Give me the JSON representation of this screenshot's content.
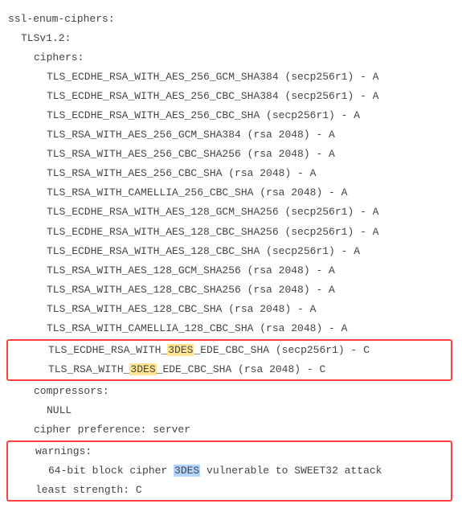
{
  "header": {
    "ssl_enum": "ssl-enum-ciphers:",
    "tls": "TLSv1.2:",
    "ciphers": "ciphers:"
  },
  "ciphers": [
    "TLS_ECDHE_RSA_WITH_AES_256_GCM_SHA384 (secp256r1) - A",
    "TLS_ECDHE_RSA_WITH_AES_256_CBC_SHA384 (secp256r1) - A",
    "TLS_ECDHE_RSA_WITH_AES_256_CBC_SHA (secp256r1) - A",
    "TLS_RSA_WITH_AES_256_GCM_SHA384 (rsa 2048) - A",
    "TLS_RSA_WITH_AES_256_CBC_SHA256 (rsa 2048) - A",
    "TLS_RSA_WITH_AES_256_CBC_SHA (rsa 2048) - A",
    "TLS_RSA_WITH_CAMELLIA_256_CBC_SHA (rsa 2048) - A",
    "TLS_ECDHE_RSA_WITH_AES_128_GCM_SHA256 (secp256r1) - A",
    "TLS_ECDHE_RSA_WITH_AES_128_CBC_SHA256 (secp256r1) - A",
    "TLS_ECDHE_RSA_WITH_AES_128_CBC_SHA (secp256r1) - A",
    "TLS_RSA_WITH_AES_128_GCM_SHA256 (rsa 2048) - A",
    "TLS_RSA_WITH_AES_128_CBC_SHA256 (rsa 2048) - A",
    "TLS_RSA_WITH_AES_128_CBC_SHA (rsa 2048) - A",
    "TLS_RSA_WITH_CAMELLIA_128_CBC_SHA (rsa 2048) - A"
  ],
  "boxed_ciphers": [
    {
      "pre": "TLS_ECDHE_RSA_WITH_",
      "hl": "3DES",
      "post": "_EDE_CBC_SHA (secp256r1) - C"
    },
    {
      "pre": "TLS_RSA_WITH_",
      "hl": "3DES",
      "post": "_EDE_CBC_SHA (rsa 2048) - C"
    }
  ],
  "compressors_label": "compressors:",
  "compressors_value": "NULL",
  "cipher_pref": "cipher preference: server",
  "warnings_label": "warnings:",
  "warning_line": {
    "pre": "64-bit block cipher ",
    "hl": "3DES",
    "post": " vulnerable to SWEET32 attack"
  },
  "least_strength": "least strength: C"
}
